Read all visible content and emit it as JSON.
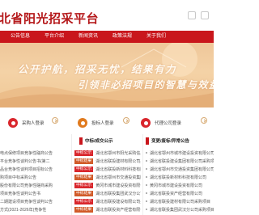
{
  "header": {
    "site_title": "北省阳光招采平台"
  },
  "nav": {
    "items": [
      {
        "label": "公告信息"
      },
      {
        "label": "平台介绍"
      },
      {
        "label": "新闻资讯"
      },
      {
        "label": "政策法规"
      },
      {
        "label": "关于我们"
      }
    ]
  },
  "banner": {
    "slogan_line1": "公开护航，招采无忧，结果有力",
    "slogan_line2": "引领非必招项目的智慧与效益"
  },
  "logins": {
    "items": [
      {
        "label": "采购人登录",
        "color": "#d9262c"
      },
      {
        "label": "投标人登录",
        "color": "#e07a1e"
      },
      {
        "label": "代理公司登录",
        "color": "#d9262c"
      }
    ]
  },
  "sections": {
    "left_title": "",
    "middle_title": "中标/成交公示",
    "right_title": "变更/废标/异常公告"
  },
  "left_list": [
    "电点保修项目竞争性磋商公告",
    "平台竞争性谈判公告书(第二",
    "品台竞争性谈判项目招标公告",
    "购项目中标采购公告",
    "股份有限公司竞争性磋商采购",
    "项目竞争性谈判公告书",
    "二期建设项目竞争性谈判公告",
    "方式(2021-2026年)竞争性"
  ],
  "middle_list": [
    {
      "tag": "中标公示",
      "tag_color": "red",
      "text": "湖北省鄂州市阳光采购信息服务平台"
    },
    {
      "tag": "中标结果",
      "tag_color": "gray",
      "text": "湖北省联投建材有限公司关于采购项目"
    },
    {
      "tag": "中标公示",
      "tag_color": "red",
      "text": "湖北省联投新材料科技有限公司中标公示"
    },
    {
      "tag": "中标结果",
      "tag_color": "gray",
      "text": "湖北省鄂州市交通投资集团有限公司"
    },
    {
      "tag": "中标公示",
      "tag_color": "red",
      "text": "黄冈市城市建设投资有限公司采购项目"
    },
    {
      "tag": "中标结果",
      "tag_color": "gray",
      "text": "湖北省联投集团武汉分公司采购项目"
    },
    {
      "tag": "中标公示",
      "tag_color": "red",
      "text": "湖北省联投建设有限公司关于招标公告"
    },
    {
      "tag": "中标结果",
      "tag_color": "gray",
      "text": "湖北省联投资产经营有限公司采购项目"
    }
  ],
  "right_list": [
    "湖北省鄂州市城市建设投资有限公司",
    "湖北省联投建设集团有限公司采购项目",
    "湖北省鄂州市交通投资集团有限公司",
    "湖北省联投新材料科技有限公司",
    "黄冈市城市建设投资有限公司",
    "湖北省联投资产经营有限公司",
    "湖北省联投建材有限公司采购项目",
    "湖北省联投集团武汉分公司采购项目"
  ]
}
